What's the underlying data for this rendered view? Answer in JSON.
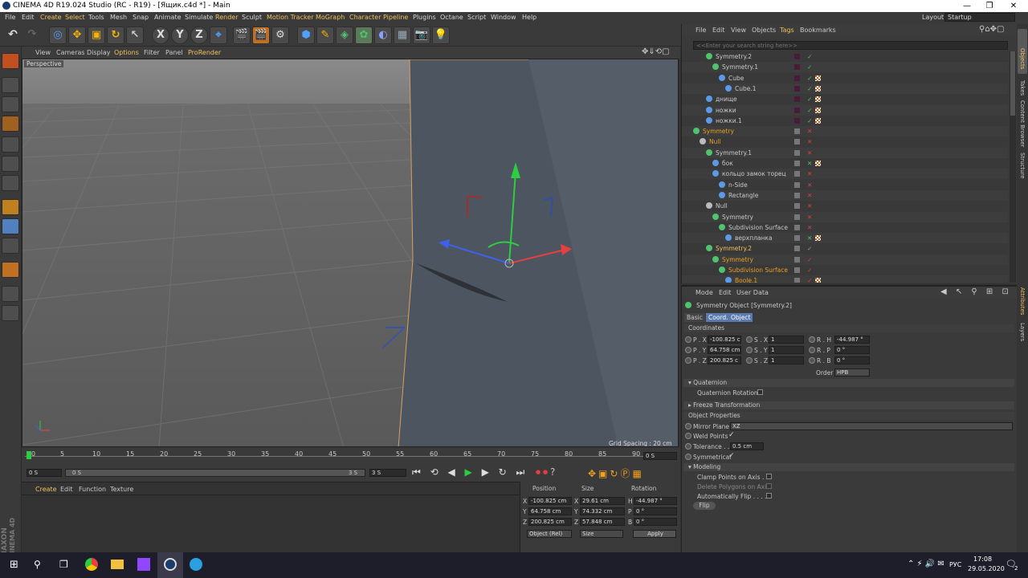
{
  "window": {
    "title": "CINEMA 4D R19.024 Studio (RC - R19) - [Ящик.c4d *] - Main",
    "minimize": "—",
    "maximize": "❐",
    "close": "✕"
  },
  "menu": {
    "items": [
      "File",
      "Edit",
      "Create",
      "Select",
      "Tools",
      "Mesh",
      "Snap",
      "Animate",
      "Simulate",
      "Render",
      "Sculpt",
      "Motion Tracker",
      "MoGraph",
      "Character",
      "Pipeline",
      "Plugins",
      "Octane",
      "Script",
      "Window",
      "Help"
    ],
    "layout_label": "Layout:",
    "layout_value": "Startup"
  },
  "toolbar": {
    "axis_labels": [
      "X",
      "Y",
      "Z"
    ]
  },
  "viewport": {
    "menu": [
      "View",
      "Cameras",
      "Display",
      "Options",
      "Filter",
      "Panel",
      "ProRender"
    ],
    "label": "Perspective",
    "grid_spacing": "Grid Spacing : 20 cm"
  },
  "timeline": {
    "ticks": [
      "0",
      "5",
      "10",
      "15",
      "20",
      "25",
      "30",
      "35",
      "40",
      "45",
      "50",
      "55",
      "60",
      "65",
      "70",
      "75",
      "80",
      "85",
      "90"
    ],
    "end_field": "0 S",
    "start_field": "0 S",
    "range_start": "0 S",
    "range_end": "3 S",
    "range_end_field": "3 S"
  },
  "material": {
    "menu": [
      "Create",
      "Edit",
      "Function",
      "Texture"
    ]
  },
  "brand": {
    "maxon": "MAXON",
    "cinema": "CINEMA 4D"
  },
  "coords": {
    "headers": [
      "Position",
      "Size",
      "Rotation"
    ],
    "rows": [
      {
        "axis": "X",
        "pos": "-100.825 cm",
        "size_axis": "X",
        "size": "29.61 cm",
        "rot_axis": "H",
        "rot": "-44.987 °"
      },
      {
        "axis": "Y",
        "pos": "64.758 cm",
        "size_axis": "Y",
        "size": "74.332 cm",
        "rot_axis": "P",
        "rot": "0 °"
      },
      {
        "axis": "Z",
        "pos": "200.825 cm",
        "size_axis": "Z",
        "size": "57.848 cm",
        "rot_axis": "B",
        "rot": "0 °"
      }
    ],
    "mode_select": "Object (Rel)",
    "size_select": "Size",
    "apply": "Apply"
  },
  "object_manager": {
    "menu": [
      "File",
      "Edit",
      "View",
      "Objects",
      "Tags",
      "Bookmarks"
    ],
    "search_placeholder": "<<Enter your search string here>>",
    "objects": [
      {
        "name": "Symmetry.2",
        "color": "#c8c8c8",
        "indent": 2
      },
      {
        "name": "Symmetry.1",
        "color": "#c8c8c8",
        "indent": 3
      },
      {
        "name": "Cube",
        "color": "#c8c8c8",
        "indent": 4
      },
      {
        "name": "Cube.1",
        "color": "#c8c8c8",
        "indent": 5
      },
      {
        "name": "днище",
        "color": "#c8c8c8",
        "indent": 2
      },
      {
        "name": "ножки",
        "color": "#c8c8c8",
        "indent": 2
      },
      {
        "name": "ножки.1",
        "color": "#c8c8c8",
        "indent": 2
      },
      {
        "name": "Symmetry",
        "color": "#e8a020",
        "indent": 0
      },
      {
        "name": "Null",
        "color": "#e8a020",
        "indent": 1
      },
      {
        "name": "Symmetry.1",
        "color": "#c8c8c8",
        "indent": 2
      },
      {
        "name": "бок",
        "color": "#c8c8c8",
        "indent": 3
      },
      {
        "name": "кольцо замок торец",
        "color": "#c8c8c8",
        "indent": 3
      },
      {
        "name": "n-Side",
        "color": "#c8c8c8",
        "indent": 4
      },
      {
        "name": "Rectangle",
        "color": "#c8c8c8",
        "indent": 4
      },
      {
        "name": "Null",
        "color": "#c8c8c8",
        "indent": 2
      },
      {
        "name": "Symmetry",
        "color": "#c8c8c8",
        "indent": 3
      },
      {
        "name": "Subdivision Surface",
        "color": "#c8c8c8",
        "indent": 4
      },
      {
        "name": "верхпланка",
        "color": "#c8c8c8",
        "indent": 5
      },
      {
        "name": "Symmetry.2",
        "color": "#f0c060",
        "indent": 2
      },
      {
        "name": "Symmetry",
        "color": "#e8a020",
        "indent": 3
      },
      {
        "name": "Subdivision Surface",
        "color": "#e8a020",
        "indent": 4
      },
      {
        "name": "Boole.1",
        "color": "#e8a020",
        "indent": 5
      }
    ]
  },
  "attributes": {
    "menu": [
      "Mode",
      "Edit",
      "User Data"
    ],
    "object_title": "Symmetry Object [Symmetry.2]",
    "tabs": [
      "Basic",
      "Coord.",
      "Object"
    ],
    "coordinates_label": "Coordinates",
    "fields": [
      {
        "l1": "P . X",
        "v1": "-100.825 c",
        "l2": "S . X",
        "v2": "1",
        "l3": "R . H",
        "v3": "-44.987 °"
      },
      {
        "l1": "P . Y",
        "v1": "64.758 cm",
        "l2": "S . Y",
        "v2": "1",
        "l3": "R . P",
        "v3": "0 °"
      },
      {
        "l1": "P . Z",
        "v1": "200.825 c",
        "l2": "S . Z",
        "v2": "1",
        "l3": "R . B",
        "v3": "0 °"
      }
    ],
    "order_label": "Order",
    "order_value": "HPB",
    "quaternion": "Quaternion",
    "quaternion_rotation": "Quaternion Rotation",
    "freeze": "Freeze Transformation",
    "object_properties": "Object Properties",
    "mirror_plane_label": "Mirror Plane",
    "mirror_plane_value": "XZ",
    "weld_points": "Weld Points",
    "tolerance_label": "Tolerance . .",
    "tolerance_value": "0.5 cm",
    "symmetrical": "Symmetrical",
    "modeling": "Modeling",
    "clamp": "Clamp Points on Axis . .",
    "delete_polys": "Delete Polygons on Axis",
    "auto_flip": "Automatically Flip . . . . .",
    "flip_button": "Flip"
  },
  "side_tabs": [
    "Objects",
    "Takes",
    "Content Browser",
    "Structure"
  ],
  "side_tabs2": [
    "Attributes",
    "Layers"
  ],
  "taskbar": {
    "lang": "РУС",
    "time": "17:08",
    "date": "29.05.2020",
    "notif": "2"
  }
}
